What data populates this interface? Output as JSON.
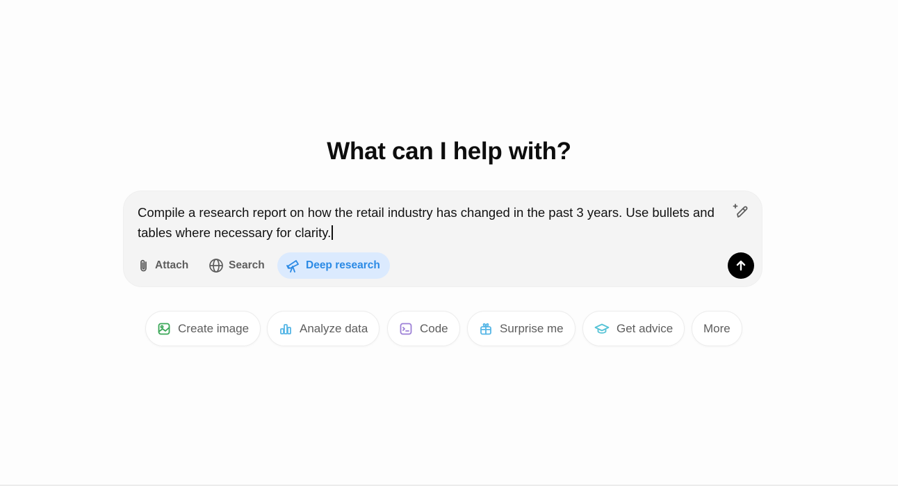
{
  "heading": "What can I help with?",
  "composer": {
    "prompt_text": "Compile a research report on how the retail industry has changed in the past 3 years. Use bullets and tables where necessary for clarity.",
    "attach_label": "Attach",
    "search_label": "Search",
    "deep_research_label": "Deep research",
    "deep_research_active": true
  },
  "suggestions": [
    {
      "label": "Create image",
      "icon": "image-icon",
      "color": "#3aa757"
    },
    {
      "label": "Analyze data",
      "icon": "bar-chart-icon",
      "color": "#56b6e6"
    },
    {
      "label": "Code",
      "icon": "terminal-icon",
      "color": "#9c7fd6"
    },
    {
      "label": "Surprise me",
      "icon": "gift-icon",
      "color": "#56b6e6"
    },
    {
      "label": "Get advice",
      "icon": "graduation-cap-icon",
      "color": "#56c3d6"
    },
    {
      "label": "More",
      "icon": "",
      "color": ""
    }
  ],
  "colors": {
    "deep_research_bg": "#dbeafe",
    "deep_research_fg": "#2b8ae5",
    "send_button": "#000000",
    "composer_bg": "#f4f4f4"
  }
}
